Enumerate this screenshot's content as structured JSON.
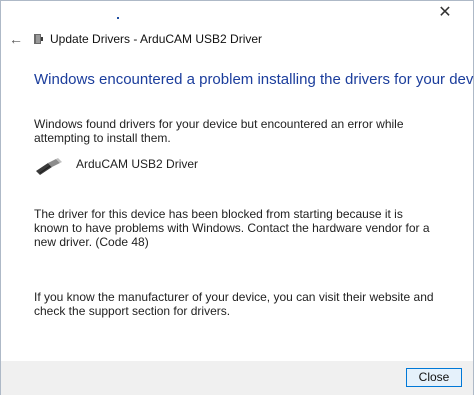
{
  "window": {
    "title": "Update Drivers - ArduCAM USB2 Driver",
    "close_glyph": "✕",
    "back_glyph": "←"
  },
  "main": {
    "heading": "Windows encountered a problem installing the drivers for your device",
    "found_message": "Windows found drivers for your device but encountered an error while attempting to install them.",
    "device_name": "ArduCAM USB2 Driver",
    "device_icon": "usb-plug-icon",
    "blocked_message": "The driver for this device has been blocked from starting because it is known to have problems with Windows. Contact the hardware vendor for a new driver. (Code 48)",
    "manufacturer_message": "If you know the manufacturer of your device, you can visit their website and check the support section for drivers."
  },
  "footer": {
    "close_label": "Close"
  },
  "colors": {
    "heading": "#1b3d9c",
    "button_border": "#0078d7",
    "button_bg": "#e5f1fb",
    "footer_bg": "#f0f0f0"
  }
}
